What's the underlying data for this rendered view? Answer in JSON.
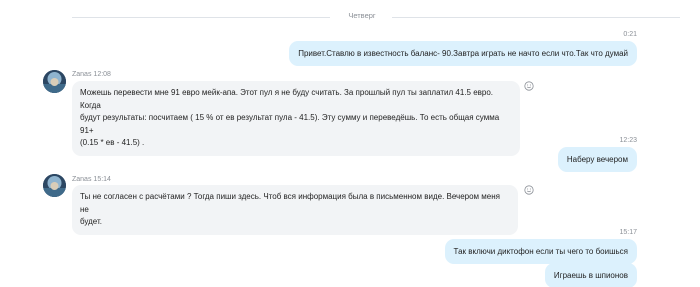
{
  "day_separator": "Четверг",
  "messages": [
    {
      "time": "0:21",
      "text": "Привет.Ставлю в известность баланс- 90.Завтра играть не начто если что.Так что думай"
    },
    {
      "sender": "Zanas",
      "time": "12:08",
      "lines": [
        "Можешь перевести мне 91 евро мейк-апа. Этот пул я не буду считать. За прошлый пул ты заплатил 41.5 евро. Когда",
        "будут результаты: посчитаем ( 15 % от ев результат пула - 41.5). Эту сумму и переведёшь. То есть общая сумма 91+",
        "(0.15 * ев - 41.5) ."
      ]
    },
    {
      "time": "12:23",
      "text": "Наберу вечером"
    },
    {
      "sender": "Zanas",
      "time": "15:14",
      "lines": [
        "Ты не согласен с расчётами ? Тогда пиши здесь. Чтоб вся информация была в письменном виде. Вечером меня не",
        "будет."
      ]
    },
    {
      "time": "15:17",
      "text": "Так включи диктофон если ты чего то боишься"
    },
    {
      "text": "Играешь в шпионов"
    }
  ],
  "icons": {
    "reaction": "smiley-icon",
    "avatar": "user-avatar"
  },
  "colors": {
    "outgoing_bubble": "#dcf1fd",
    "incoming_bubble": "#f2f4f6",
    "meta_text": "#8a8f96"
  }
}
